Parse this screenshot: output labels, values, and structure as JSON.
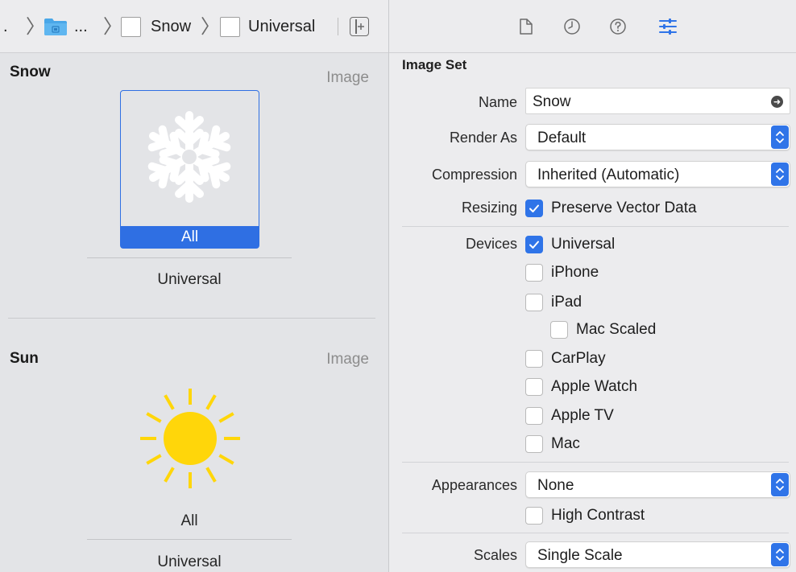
{
  "breadcrumb": {
    "leading_dot": ".",
    "separator": "〉",
    "ellipsis": "...",
    "items": [
      {
        "label": "Snow"
      },
      {
        "label": "Universal"
      }
    ]
  },
  "canvas": {
    "sets": [
      {
        "title": "Snow",
        "kind": "Image",
        "well_label": "All",
        "group_label": "Universal",
        "icon": "snowflake-icon",
        "icon_color": "#ffffff"
      },
      {
        "title": "Sun",
        "kind": "Image",
        "well_label": "All",
        "group_label": "Universal",
        "icon": "sun-icon",
        "icon_color": "#ffd60a"
      }
    ],
    "accent": "#2f6fe3"
  },
  "inspector": {
    "toolbar_icons": [
      "file-inspector-icon",
      "history-inspector-icon",
      "quick-help-icon",
      "attributes-inspector-icon"
    ],
    "heading": "Image Set",
    "name": {
      "label": "Name",
      "value": "Snow"
    },
    "render_as": {
      "label": "Render As",
      "value": "Default"
    },
    "compression": {
      "label": "Compression",
      "value": "Inherited (Automatic)"
    },
    "resizing": {
      "label": "Resizing",
      "option": "Preserve Vector Data",
      "checked": true
    },
    "devices": {
      "label": "Devices",
      "options": [
        {
          "label": "Universal",
          "checked": true
        },
        {
          "label": "iPhone",
          "checked": false
        },
        {
          "label": "iPad",
          "checked": false
        },
        {
          "label": "Mac Scaled",
          "checked": false
        },
        {
          "label": "CarPlay",
          "checked": false
        },
        {
          "label": "Apple Watch",
          "checked": false
        },
        {
          "label": "Apple TV",
          "checked": false
        },
        {
          "label": "Mac",
          "checked": false
        }
      ]
    },
    "appearances": {
      "label": "Appearances",
      "value": "None",
      "high_contrast": {
        "label": "High Contrast",
        "checked": false
      }
    },
    "scales": {
      "label": "Scales",
      "value": "Single Scale"
    },
    "accent": "#2f74e8"
  }
}
